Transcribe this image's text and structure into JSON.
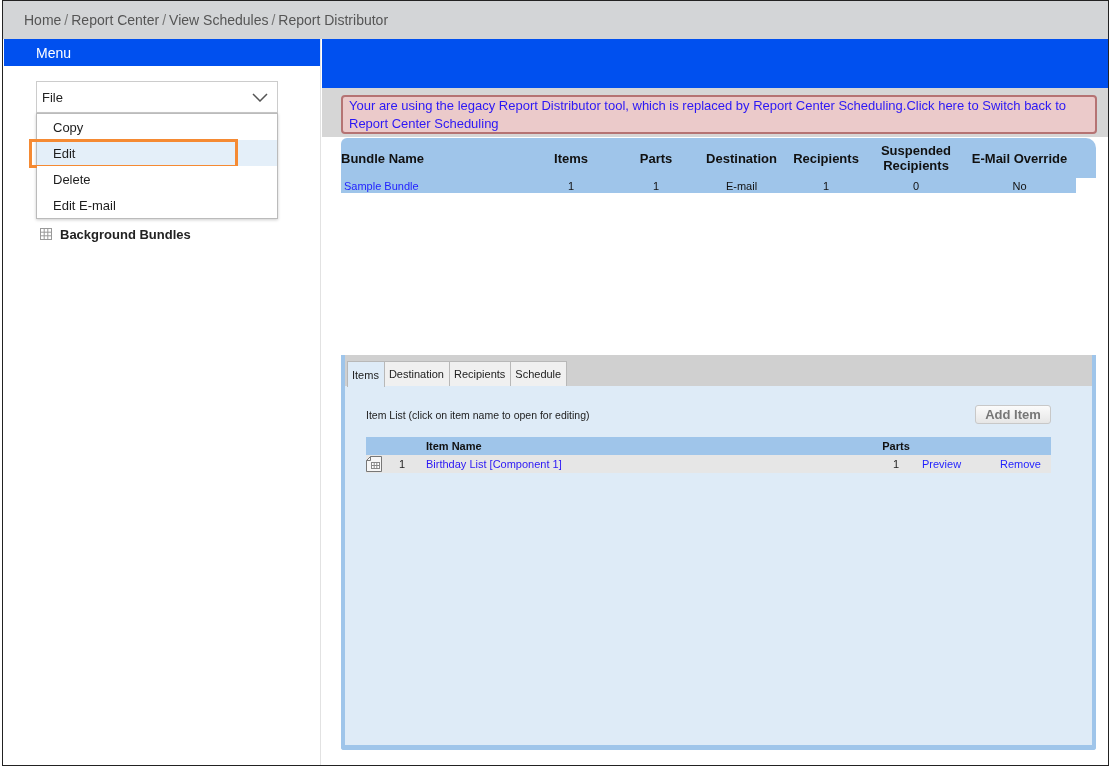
{
  "breadcrumb": {
    "separator": "/",
    "items": [
      {
        "label": "Home"
      },
      {
        "label": "Report Center"
      },
      {
        "label": "View Schedules"
      },
      {
        "label": "Report Distributor"
      }
    ]
  },
  "menu": {
    "title": "Menu",
    "dropdown": {
      "value": "File",
      "expanded": true,
      "options": [
        {
          "label": "Copy",
          "selected": false,
          "highlighted": false
        },
        {
          "label": "Edit",
          "selected": true,
          "highlighted": true
        },
        {
          "label": "Delete",
          "selected": false,
          "highlighted": false
        },
        {
          "label": "Edit E-mail",
          "selected": false,
          "highlighted": false
        }
      ]
    },
    "items": [
      {
        "label": "Background Bundles"
      }
    ]
  },
  "notice": {
    "text": "Your are using the legacy Report Distributor tool, which is replaced by Report Center Scheduling.Click here to Switch back to Report Center Scheduling"
  },
  "bundles": {
    "columns": [
      "Bundle Name",
      "Items",
      "Parts",
      "Destination",
      "Recipients",
      "Suspended Recipients",
      "E-Mail Override"
    ],
    "rows": [
      {
        "cells": [
          "Sample Bundle",
          "1",
          "1",
          "E-mail",
          "1",
          "0",
          "No"
        ]
      }
    ]
  },
  "tabs": [
    {
      "label": "Items",
      "selected": true
    },
    {
      "label": "Destination",
      "selected": false
    },
    {
      "label": "Recipients",
      "selected": false
    },
    {
      "label": "Schedule",
      "selected": false
    }
  ],
  "item_list": {
    "caption": "Item List (click on item name to open for editing)",
    "add_button": "Add Item",
    "columns": {
      "name": "Item Name",
      "parts": "Parts"
    },
    "rows": [
      {
        "number": "1",
        "name": "Birthday List [Component 1]",
        "parts": "1",
        "preview": "Preview",
        "remove": "Remove"
      }
    ]
  }
}
